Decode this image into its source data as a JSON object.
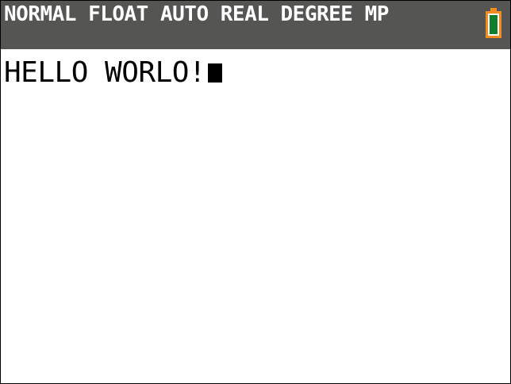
{
  "status_bar": {
    "modes": "NORMAL FLOAT AUTO REAL DEGREE MP",
    "battery_icon": "battery-icon",
    "colors": {
      "background": "#555553",
      "text": "#ffffff",
      "battery_outline": "#f58a1f",
      "battery_fill": "#0f7d2e"
    }
  },
  "home_screen": {
    "entry_text": "HELLO WORLO!",
    "cursor_icon": "cursor-block-icon"
  }
}
